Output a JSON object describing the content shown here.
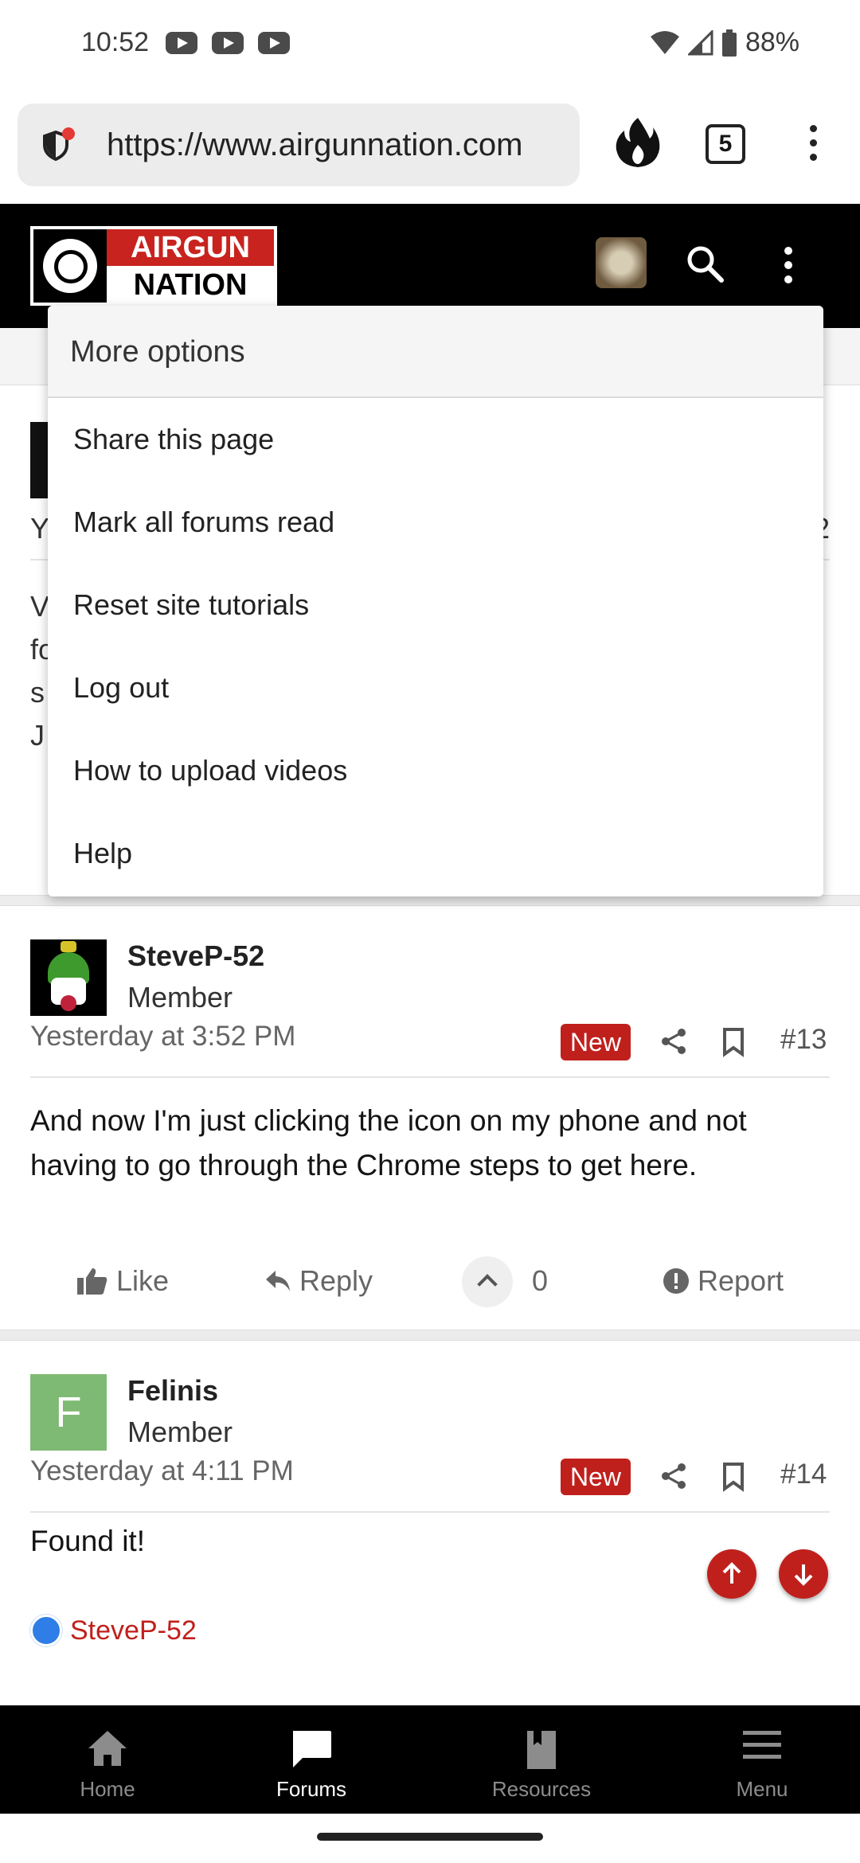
{
  "status_bar": {
    "time": "10:52",
    "battery": "88%"
  },
  "browser": {
    "url": "https://www.airgunnation.com",
    "tab_count": "5"
  },
  "site": {
    "logo_line1": "AIRGUN",
    "logo_line2": "NATION",
    "accent_color": "#c0201c"
  },
  "background_post": {
    "meta_left": "Y",
    "meta_right": "2",
    "body_lines": [
      "V",
      "fo",
      "s",
      "J"
    ]
  },
  "menu": {
    "title": "More options",
    "items": [
      {
        "label": "Share this page"
      },
      {
        "label": "Mark all forums read"
      },
      {
        "label": "Reset site tutorials"
      },
      {
        "label": "Log out"
      },
      {
        "label": "How to upload videos"
      },
      {
        "label": "Help"
      }
    ]
  },
  "posts": [
    {
      "username": "SteveP-52",
      "role": "Member",
      "date": "Yesterday at 3:52 PM",
      "badge": "New",
      "number": "#13",
      "body": "And now I'm just clicking the icon on my phone and not having to go through the Chrome steps to get here.",
      "actions": {
        "like": "Like",
        "reply": "Reply",
        "votes": "0",
        "report": "Report"
      }
    },
    {
      "username": "Felinis",
      "role": "Member",
      "avatar_letter": "F",
      "date": "Yesterday at 4:11 PM",
      "badge": "New",
      "number": "#14",
      "body": "Found it!",
      "reaction_user": "SteveP-52"
    }
  ],
  "bottom_nav": [
    {
      "label": "Home",
      "icon": "home-icon"
    },
    {
      "label": "Forums",
      "icon": "forums-icon",
      "active": true
    },
    {
      "label": "Resources",
      "icon": "resources-icon"
    },
    {
      "label": "Menu",
      "icon": "menu-icon"
    }
  ]
}
